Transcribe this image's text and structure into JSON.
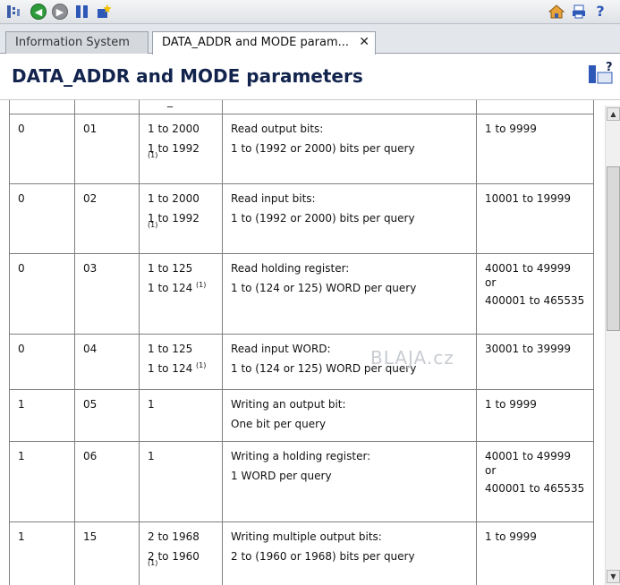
{
  "tabs": [
    {
      "label": "Information System"
    },
    {
      "label": "DATA_ADDR and MODE param..."
    }
  ],
  "page": {
    "title": "DATA_ADDR and MODE parameters"
  },
  "table": {
    "rows": [
      {
        "mode": "0",
        "func": "01",
        "range": [
          "1 to 2000",
          "1 to 1992"
        ],
        "footnote": "(1)",
        "desc": "Read output bits:",
        "detail": "1 to (1992 or 2000) bits per query",
        "addr": [
          "1 to 9999"
        ]
      },
      {
        "mode": "0",
        "func": "02",
        "range": [
          "1 to 2000",
          "1 to 1992"
        ],
        "footnote": "(1)",
        "desc": "Read input bits:",
        "detail": "1 to (1992 or 2000) bits per query",
        "addr": [
          "10001 to 19999"
        ]
      },
      {
        "mode": "0",
        "func": "03",
        "range": [
          "1 to 125",
          "1 to 124"
        ],
        "footnote": "(1)",
        "desc": "Read holding register:",
        "detail": "1 to (124 or 125) WORD per query",
        "addr": [
          "40001 to 49999",
          "or",
          "400001 to 465535"
        ]
      },
      {
        "mode": "0",
        "func": "04",
        "range": [
          "1 to 125",
          "1 to 124"
        ],
        "footnote": "(1)",
        "desc": "Read input WORD:",
        "detail": "1 to (124 or 125) WORD per query",
        "addr": [
          "30001 to 39999"
        ]
      },
      {
        "mode": "1",
        "func": "05",
        "range": [
          "1"
        ],
        "footnote": "",
        "desc": "Writing an output bit:",
        "detail": "One bit per query",
        "addr": [
          "1 to 9999"
        ]
      },
      {
        "mode": "1",
        "func": "06",
        "range": [
          "1"
        ],
        "footnote": "",
        "desc": "Writing a holding register:",
        "detail": "1 WORD per query",
        "addr": [
          "40001 to 49999",
          "or",
          "400001 to 465535"
        ]
      },
      {
        "mode": "1",
        "func": "15",
        "range": [
          "2 to 1968",
          "2 to 1960"
        ],
        "footnote": "(1)",
        "desc": "Writing multiple output bits:",
        "detail": "2 to (1960 or 1968) bits per query",
        "addr": [
          "1 to 9999"
        ]
      }
    ]
  },
  "header_fragment": "_",
  "watermark": "BLAJA.cz",
  "icons": {
    "toolbar": [
      "tree-sync-icon",
      "back-icon",
      "forward-icon",
      "bookmarks-icon",
      "new-bookmark-icon",
      "home-icon",
      "print-icon",
      "help-icon"
    ],
    "page": "context-help-icon"
  },
  "colors": {
    "title": "#12244d",
    "back": "#2e9a3a",
    "forward": "#8c8f94"
  }
}
